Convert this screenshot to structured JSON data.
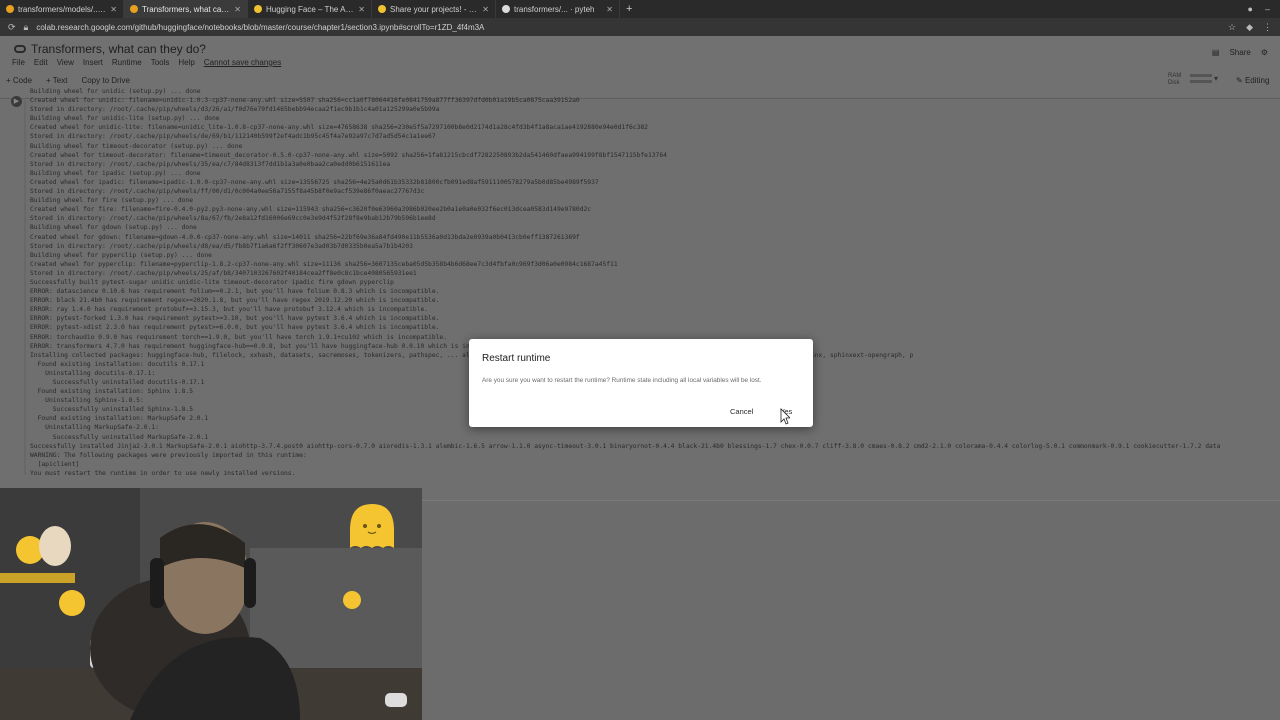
{
  "browser": {
    "tabs": [
      {
        "title": "transformers/models/... hugging",
        "active": false
      },
      {
        "title": "Transformers, what can they do?",
        "active": true
      },
      {
        "title": "Hugging Face – The AI community",
        "active": false
      },
      {
        "title": "Share your projects! - Course",
        "active": false
      },
      {
        "title": "transformers/... · pyteh",
        "active": false
      }
    ],
    "new_tab": "+",
    "url": "colab.research.google.com/github/huggingface/notebooks/blob/master/course/chapter1/section3.ipynb#scrollTo=r1ZD_4f4m3A"
  },
  "colab": {
    "notebook_title": "Transformers, what can they do?",
    "menus": [
      "File",
      "Edit",
      "View",
      "Insert",
      "Runtime",
      "Tools",
      "Help"
    ],
    "changes_link": "Cannot save changes",
    "toolbar": {
      "code": "+ Code",
      "text": "+ Text",
      "copy_drive": "Copy to Drive"
    },
    "share": "Share",
    "ram_label": "RAM",
    "disk_label": "Disk",
    "editing": "Editing"
  },
  "output_lines": [
    "Building wheel for unidic (setup.py) ... done",
    "Created wheel for unidic: filename=unidic-1.0.3-cp37-none-any.whl size=5507 sha256=cc1a0f78064416fe0841759a877ff36397dfd0b01a19b5ca0875caa39152a0",
    "Stored in directory: /root/.cache/pip/wheels/d3/26/a1/f0d76e79fd1465bebb94ecaa2f1ec9b1b1c4a01a125299a0e5b99a",
    "Building wheel for unidic-lite (setup.py) ... done",
    "Created wheel for unidic-lite: filename=unidic_lite-1.0.8-cp37-none-any.whl size=47658638 sha256=230e5f5a7297100b8e0d2174d1a28c4fd3b4f1a8aca1ae4192880e94e0d1f6c382",
    "Stored in directory: /root/.cache/pip/wheels/de/69/b1/112140b599f2ef4adc1b95c45f4a7e92a97c7d7ad5d54c1a1ee67",
    "Building wheel for timeout-decorator (setup.py) ... done",
    "Created wheel for timeout-decorator: filename=timeout_decorator-0.5.0-cp37-none-any.whl size=5092 sha256=1fa81215cbcdf7282250893b2da541460dfaea994199f8bf1547115bfe13764",
    "Stored in directory: /root/.cache/pip/wheels/35/ea/c7/84d8313f7dd1b1a3a0e0baa2ca0edd0b6151611ea",
    "Building wheel for ipadic (setup.py) ... done",
    "Created wheel for ipadic: filename=ipadic-1.0.0-cp37-none-any.whl size=13556725 sha256=4e25a0d61b35332b81800cfb091ed8af5911100578279a5b0d85be4989f5937",
    "Stored in directory: /root/.cache/pip/wheels/ff/00/d1/0c004a0ee56a7155f8a45b8f0e9acf539e86f0aeac27767d3c",
    "Building wheel for fire (setup.py) ... done",
    "Created wheel for fire: filename=fire-0.4.0-py2.py3-none-any.whl size=115943 sha256=c3620f0e63960a3986b020ee2b0a1e0a0e032f6ec013dcea0583d149e9780d2c",
    "Stored in directory: /root/.cache/pip/wheels/8a/67/fb/2e8a12fd16006e69cc0e3e9d4f52f28f8e9bab12b79b596b1ee8d",
    "Building wheel for gdown (setup.py) ... done",
    "Created wheel for gdown: filename=gdown-4.0.0-cp37-none-any.whl size=14011 sha256=22bf69e36a84fd490e11b5536a0d13bda2e0939a0b0413cb0eff1387261369f",
    "Stored in directory: /root/.cache/pip/wheels/d8/ea/d5/fb8b7f1a6a6f2ff30607e3ad03b7d0335b0ea5a7b1b4203",
    "Building wheel for pyperclip (setup.py) ... done",
    "Created wheel for pyperclip: filename=pyperclip-1.8.2-cp37-none-any.whl size=11136 sha256=3607135ceba05d5b358b4b6d68ee7c3d4fbfa0c969f3d06a0e0984c1687a45f11",
    "Stored in directory: /root/.cache/pip/wheels/25/af/b8/3407103267602f40184cea2ff8e0c8c1bce4080565931ee1",
    "Successfully built pytest-sugar unidic unidic-lite timeout-decorator ipadic fire gdown pyperclip",
    "ERROR: datascience 0.10.6 has requirement folium==0.2.1, but you'll have folium 0.8.3 which is incompatible.",
    "ERROR: black 21.4b0 has requirement regex>=2020.1.8, but you'll have regex 2019.12.20 which is incompatible.",
    "ERROR: ray 1.4.0 has requirement protobuf>=3.15.3, but you'll have protobuf 3.12.4 which is incompatible.",
    "ERROR: pytest-forked 1.3.0 has requirement pytest>=3.10, but you'll have pytest 3.6.4 which is incompatible.",
    "ERROR: pytest-xdist 2.3.0 has requirement pytest>=6.0.0, but you'll have pytest 3.6.4 which is incompatible.",
    "ERROR: torchaudio 0.9.0 has requirement torch==1.9.0, but you'll have torch 1.9.1+cu102 which is incompatible.",
    "ERROR: transformers 4.7.0 has requirement huggingface-hub==0.0.8, but you'll have huggingface-hub 0.0.10 which is incompatible.",
    "Installing collected packages: huggingface-hub, filelock, xxhash, datasets, sacremoses, tokenizers, pathspec, ... alabaster, sphinxcontrib-htmlhelp, sphinxcontrib-qthelp, sphinxcontrib-jsmath, docutils, sphinx, sphinxext-opengraph, p",
    "  Found existing installation: docutils 0.17.1",
    "    Uninstalling docutils-0.17.1:",
    "      Successfully uninstalled docutils-0.17.1",
    "  Found existing installation: Sphinx 1.8.5",
    "    Uninstalling Sphinx-1.8.5:",
    "      Successfully uninstalled Sphinx-1.8.5",
    "  Found existing installation: MarkupSafe 2.0.1",
    "    Uninstalling MarkupSafe-2.0.1:",
    "      Successfully uninstalled MarkupSafe-2.0.1",
    "Successfully installed Jinja2-3.0.1 MarkupSafe-2.0.1 aiohttp-3.7.4.post0 aiohttp-cors-0.7.0 aioredis-1.3.1 alembic-1.6.5 arrow-1.1.0 async-timeout-3.0.1 binaryornot-0.4.4 black-21.4b0 blessings-1.7 chex-0.0.7 cliff-3.8.0 cmaes-0.8.2 cmd2-2.1.0 colorama-0.4.4 colorlog-5.0.1 commonmark-0.9.1 cookiecutter-1.7.2 data",
    "WARNING: The following packages were previously imported in this runtime:",
    "  [apiclient]",
    "You must restart the runtime in order to use newly installed versions."
  ],
  "dialog": {
    "title": "Restart runtime",
    "message": "Are you sure you want to restart the runtime? Runtime state including all local variables will be lost.",
    "cancel": "Cancel",
    "yes": "Yes"
  },
  "colors": {
    "dim_background": "#6f6f6f",
    "dialog_bg": "#ffffff",
    "sticker_yellow": "#f5c531"
  }
}
